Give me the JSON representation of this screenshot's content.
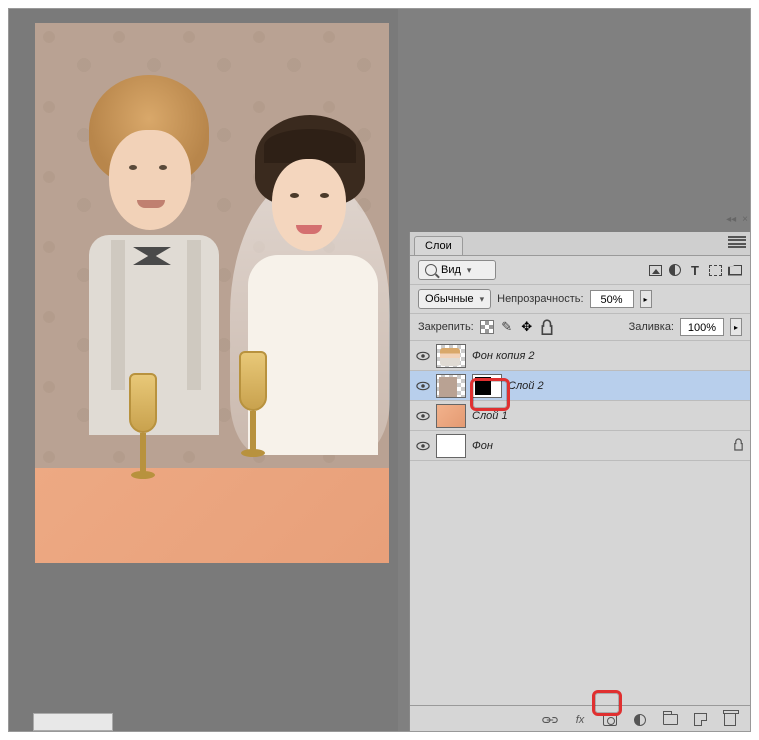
{
  "panel": {
    "title": "Слои",
    "search_label": "Вид",
    "blend_mode": "Обычные",
    "opacity_label": "Непрозрачность:",
    "opacity_value": "50%",
    "lock_label": "Закрепить:",
    "fill_label": "Заливка:",
    "fill_value": "100%"
  },
  "layers": [
    {
      "name": "Фон копия 2"
    },
    {
      "name": "Слой 2"
    },
    {
      "name": "Слой 1"
    },
    {
      "name": "Фон"
    }
  ],
  "footer": {
    "fx": "fx"
  },
  "top_icons": {
    "collapse": "◂◂",
    "close": "×"
  }
}
